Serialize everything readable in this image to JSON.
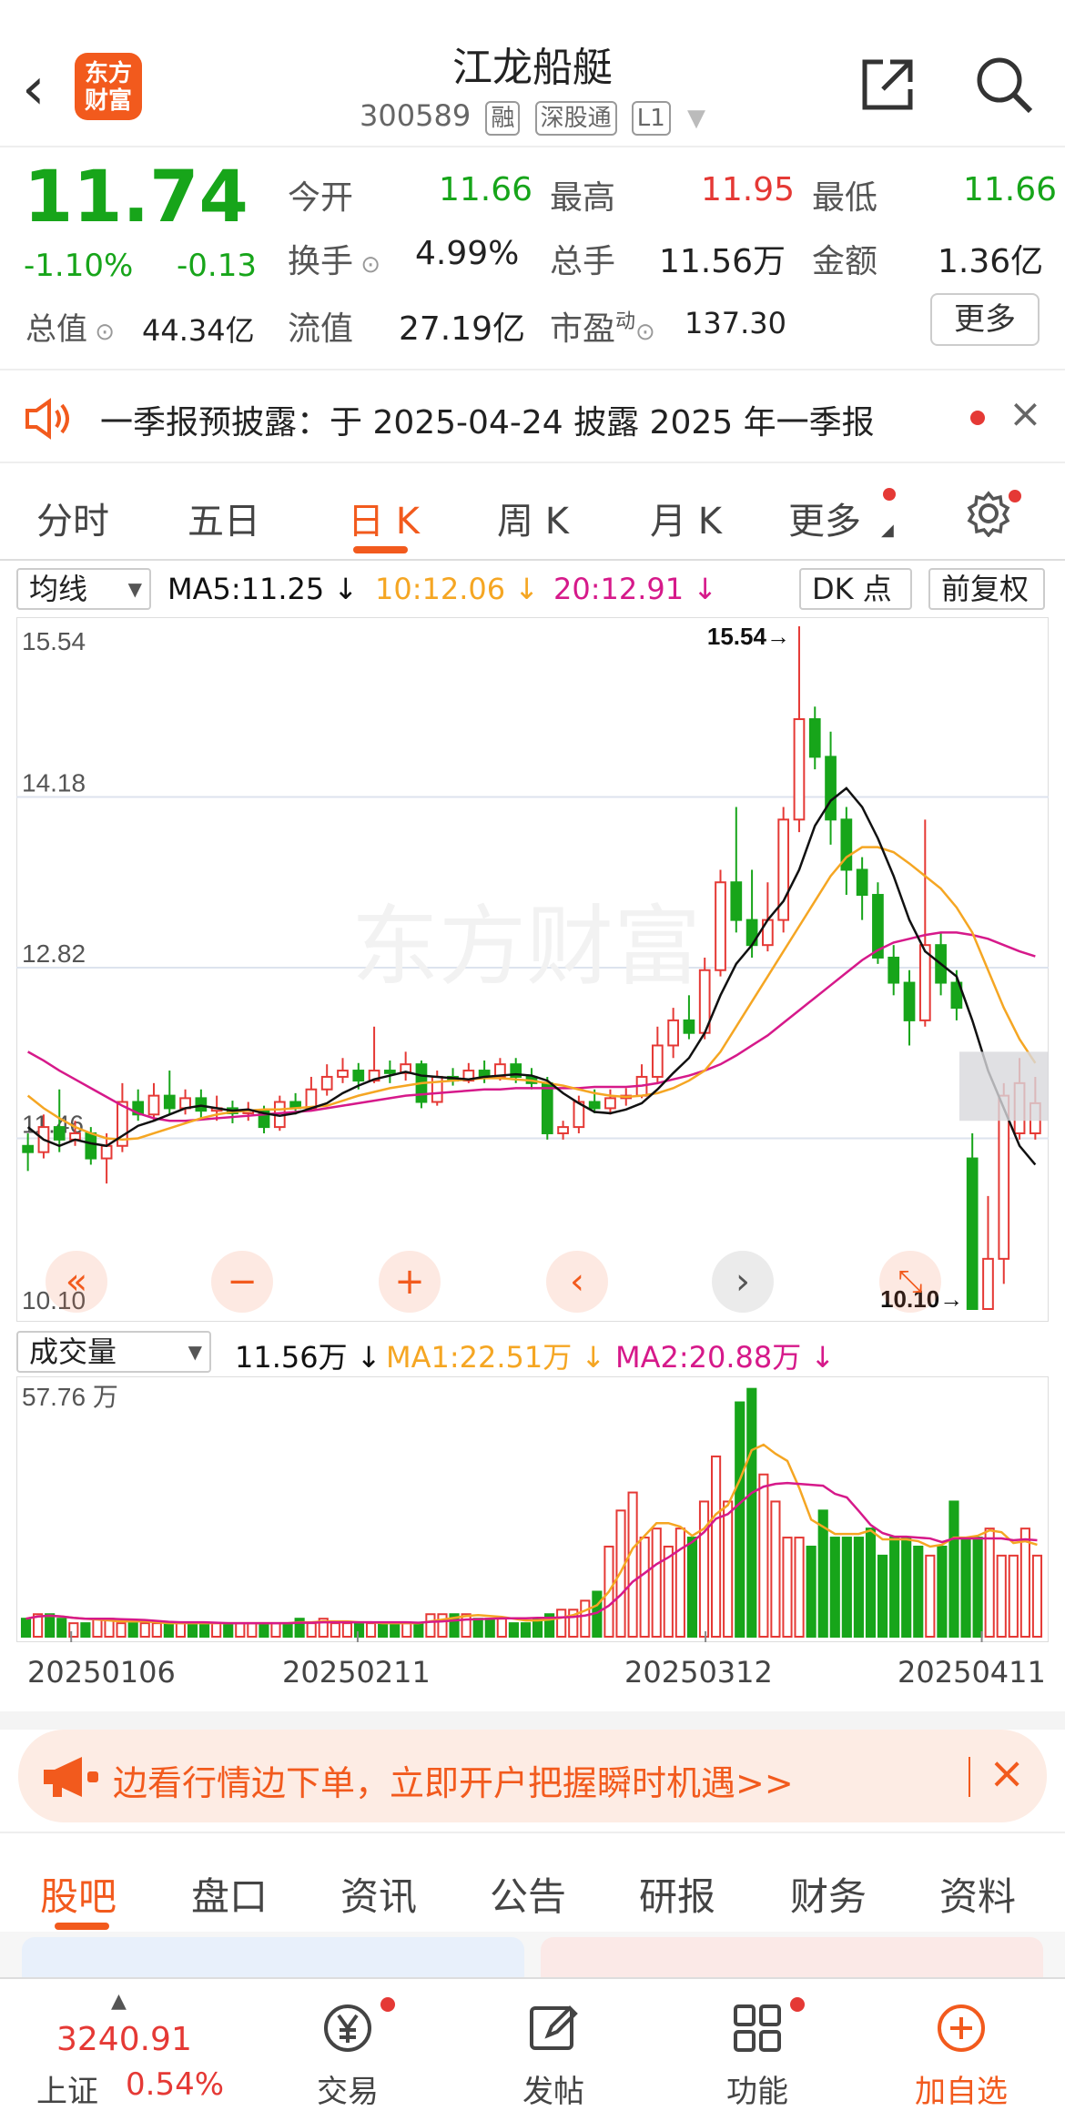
{
  "header": {
    "title": "江龙船艇",
    "code": "300589",
    "tags": [
      "融",
      "深股通",
      "L1"
    ],
    "logo": "东方财富"
  },
  "quote": {
    "price": "11.74",
    "change_pct": "-1.10%",
    "change": "-0.13",
    "open_label": "今开",
    "open": "11.66",
    "high_label": "最高",
    "high": "11.95",
    "low_label": "最低",
    "low": "11.66",
    "turnover_label": "换手",
    "turnover": "4.99%",
    "volume_label": "总手",
    "volume": "11.56万",
    "amount_label": "金额",
    "amount": "1.36亿",
    "mktcap_label": "总值",
    "mktcap": "44.34亿",
    "float_label": "流值",
    "float": "27.19亿",
    "pe_label": "市盈",
    "pe_sup": "动",
    "pe": "137.30",
    "more_label": "更多"
  },
  "notice": {
    "text": "一季报预披露：于 2025-04-24 披露 2025 年一季报"
  },
  "tabs": [
    {
      "label": "分时"
    },
    {
      "label": "五日"
    },
    {
      "label": "日 K"
    },
    {
      "label": "周 K"
    },
    {
      "label": "月 K"
    },
    {
      "label": "更多"
    }
  ],
  "chartbar": {
    "indicator": "均线",
    "ma5": "MA5:11.25 ↓",
    "ma10": "10:12.06 ↓",
    "ma20": "20:12.91 ↓",
    "dk": "DK 点",
    "adjust": "前复权"
  },
  "kline": {
    "axis_labels": [
      "15.54",
      "14.18",
      "12.82",
      "11.46",
      "10.10"
    ],
    "max_label": "15.54→",
    "min_label": "10.10→",
    "watermark": "东方财富"
  },
  "volbar": {
    "indicator": "成交量",
    "vol": "11.56万 ↓",
    "ma1": "MA1:22.51万 ↓",
    "ma2": "MA2:20.88万 ↓",
    "max_label": "57.76 万"
  },
  "dates": [
    "20250106",
    "20250211",
    "20250312",
    "20250411"
  ],
  "ad": {
    "text": "边看行情边下单，立即开户把握瞬时机遇>>"
  },
  "subtabs": [
    {
      "label": "股吧"
    },
    {
      "label": "盘口"
    },
    {
      "label": "资讯"
    },
    {
      "label": "公告"
    },
    {
      "label": "研报"
    },
    {
      "label": "财务"
    },
    {
      "label": "资料"
    }
  ],
  "bottom": {
    "index_value": "3240.91",
    "index_name": "上证",
    "index_change": "0.54%",
    "items": [
      {
        "label": "交易"
      },
      {
        "label": "发帖"
      },
      {
        "label": "功能"
      },
      {
        "label": "加自选"
      }
    ]
  },
  "colors": {
    "up": "#e53935",
    "down": "#17a51a",
    "accent": "#f25a1d",
    "ma5": "#111111",
    "ma10": "#f5a623",
    "ma20": "#d6198a"
  },
  "chart_data": {
    "type": "candlestick",
    "price_axis": [
      10.1,
      15.54
    ],
    "candles": [
      {
        "o": 11.4,
        "c": 11.35,
        "h": 11.5,
        "l": 11.2
      },
      {
        "o": 11.35,
        "c": 11.55,
        "h": 11.65,
        "l": 11.3
      },
      {
        "o": 11.55,
        "c": 11.45,
        "h": 11.85,
        "l": 11.35
      },
      {
        "o": 11.45,
        "c": 11.5,
        "h": 11.6,
        "l": 11.4
      },
      {
        "o": 11.5,
        "c": 11.3,
        "h": 11.55,
        "l": 11.25
      },
      {
        "o": 11.3,
        "c": 11.4,
        "h": 11.5,
        "l": 11.1
      },
      {
        "o": 11.4,
        "c": 11.75,
        "h": 11.9,
        "l": 11.35
      },
      {
        "o": 11.75,
        "c": 11.65,
        "h": 11.85,
        "l": 11.6
      },
      {
        "o": 11.65,
        "c": 11.8,
        "h": 11.9,
        "l": 11.6
      },
      {
        "o": 11.8,
        "c": 11.7,
        "h": 12.0,
        "l": 11.65
      },
      {
        "o": 11.7,
        "c": 11.78,
        "h": 11.85,
        "l": 11.65
      },
      {
        "o": 11.78,
        "c": 11.68,
        "h": 11.85,
        "l": 11.62
      },
      {
        "o": 11.68,
        "c": 11.7,
        "h": 11.8,
        "l": 11.6
      },
      {
        "o": 11.7,
        "c": 11.66,
        "h": 11.76,
        "l": 11.58
      },
      {
        "o": 11.66,
        "c": 11.68,
        "h": 11.75,
        "l": 11.6
      },
      {
        "o": 11.68,
        "c": 11.55,
        "h": 11.72,
        "l": 11.5
      },
      {
        "o": 11.55,
        "c": 11.75,
        "h": 11.8,
        "l": 11.52
      },
      {
        "o": 11.75,
        "c": 11.7,
        "h": 11.82,
        "l": 11.65
      },
      {
        "o": 11.7,
        "c": 11.85,
        "h": 11.95,
        "l": 11.68
      },
      {
        "o": 11.85,
        "c": 11.95,
        "h": 12.05,
        "l": 11.8
      },
      {
        "o": 11.95,
        "c": 12.0,
        "h": 12.1,
        "l": 11.9
      },
      {
        "o": 12.0,
        "c": 11.92,
        "h": 12.06,
        "l": 11.85
      },
      {
        "o": 11.92,
        "c": 12.0,
        "h": 12.35,
        "l": 11.9
      },
      {
        "o": 12.0,
        "c": 11.98,
        "h": 12.08,
        "l": 11.9
      },
      {
        "o": 11.98,
        "c": 12.05,
        "h": 12.15,
        "l": 11.92
      },
      {
        "o": 12.05,
        "c": 11.75,
        "h": 12.08,
        "l": 11.7
      },
      {
        "o": 11.75,
        "c": 11.95,
        "h": 12.0,
        "l": 11.72
      },
      {
        "o": 11.95,
        "c": 11.92,
        "h": 12.02,
        "l": 11.88
      },
      {
        "o": 11.92,
        "c": 12.0,
        "h": 12.06,
        "l": 11.9
      },
      {
        "o": 12.0,
        "c": 11.95,
        "h": 12.08,
        "l": 11.9
      },
      {
        "o": 11.95,
        "c": 12.05,
        "h": 12.1,
        "l": 11.92
      },
      {
        "o": 12.05,
        "c": 11.95,
        "h": 12.1,
        "l": 11.9
      },
      {
        "o": 11.95,
        "c": 11.9,
        "h": 12.02,
        "l": 11.85
      },
      {
        "o": 11.9,
        "c": 11.5,
        "h": 11.95,
        "l": 11.45
      },
      {
        "o": 11.5,
        "c": 11.55,
        "h": 11.6,
        "l": 11.45
      },
      {
        "o": 11.55,
        "c": 11.75,
        "h": 11.8,
        "l": 11.5
      },
      {
        "o": 11.75,
        "c": 11.7,
        "h": 11.85,
        "l": 11.66
      },
      {
        "o": 11.7,
        "c": 11.78,
        "h": 11.85,
        "l": 11.65
      },
      {
        "o": 11.78,
        "c": 11.8,
        "h": 11.86,
        "l": 11.72
      },
      {
        "o": 11.8,
        "c": 11.95,
        "h": 12.05,
        "l": 11.78
      },
      {
        "o": 11.95,
        "c": 12.2,
        "h": 12.35,
        "l": 11.9
      },
      {
        "o": 12.2,
        "c": 12.4,
        "h": 12.5,
        "l": 12.1
      },
      {
        "o": 12.4,
        "c": 12.3,
        "h": 12.6,
        "l": 12.25
      },
      {
        "o": 12.3,
        "c": 12.8,
        "h": 12.9,
        "l": 12.25
      },
      {
        "o": 12.8,
        "c": 13.5,
        "h": 13.6,
        "l": 12.75
      },
      {
        "o": 13.5,
        "c": 13.2,
        "h": 14.1,
        "l": 13.1
      },
      {
        "o": 13.2,
        "c": 13.0,
        "h": 13.6,
        "l": 12.9
      },
      {
        "o": 13.0,
        "c": 13.2,
        "h": 13.5,
        "l": 12.95
      },
      {
        "o": 13.2,
        "c": 14.0,
        "h": 14.1,
        "l": 13.1
      },
      {
        "o": 14.0,
        "c": 14.8,
        "h": 15.54,
        "l": 13.9
      },
      {
        "o": 14.8,
        "c": 14.5,
        "h": 14.9,
        "l": 14.4
      },
      {
        "o": 14.5,
        "c": 14.0,
        "h": 14.7,
        "l": 13.8
      },
      {
        "o": 14.0,
        "c": 13.6,
        "h": 14.1,
        "l": 13.4
      },
      {
        "o": 13.6,
        "c": 13.4,
        "h": 13.7,
        "l": 13.2
      },
      {
        "o": 13.4,
        "c": 12.9,
        "h": 13.5,
        "l": 12.85
      },
      {
        "o": 12.9,
        "c": 12.7,
        "h": 13.0,
        "l": 12.6
      },
      {
        "o": 12.7,
        "c": 12.4,
        "h": 12.8,
        "l": 12.2
      },
      {
        "o": 12.4,
        "c": 13.0,
        "h": 14.0,
        "l": 12.35
      },
      {
        "o": 13.0,
        "c": 12.7,
        "h": 13.1,
        "l": 12.6
      },
      {
        "o": 12.7,
        "c": 12.5,
        "h": 12.8,
        "l": 12.4
      },
      {
        "o": 11.3,
        "c": 10.1,
        "h": 11.5,
        "l": 10.1
      },
      {
        "o": 10.1,
        "c": 10.5,
        "h": 11.0,
        "l": 10.1
      },
      {
        "o": 10.5,
        "c": 11.8,
        "h": 11.9,
        "l": 10.3
      },
      {
        "o": 11.5,
        "c": 11.9,
        "h": 12.1,
        "l": 11.45
      },
      {
        "o": 11.5,
        "c": 11.74,
        "h": 11.95,
        "l": 11.45
      }
    ],
    "ma5": [
      11.55,
      11.45,
      11.4,
      11.45,
      11.42,
      11.4,
      11.48,
      11.56,
      11.6,
      11.65,
      11.7,
      11.72,
      11.7,
      11.68,
      11.69,
      11.66,
      11.64,
      11.66,
      11.7,
      11.74,
      11.82,
      11.88,
      11.93,
      11.96,
      11.99,
      11.96,
      11.95,
      11.94,
      11.93,
      11.95,
      11.96,
      11.97,
      11.96,
      11.92,
      11.82,
      11.74,
      11.67,
      11.66,
      11.69,
      11.74,
      11.85,
      11.98,
      12.1,
      12.3,
      12.6,
      12.85,
      13.0,
      13.2,
      13.35,
      13.6,
      13.95,
      14.15,
      14.25,
      14.1,
      13.85,
      13.55,
      13.2,
      12.95,
      12.85,
      12.75,
      12.4,
      12.0,
      11.7,
      11.4,
      11.25
    ],
    "ma10": [
      11.8,
      11.7,
      11.62,
      11.55,
      11.5,
      11.46,
      11.45,
      11.46,
      11.5,
      11.54,
      11.58,
      11.62,
      11.65,
      11.67,
      11.68,
      11.69,
      11.69,
      11.7,
      11.71,
      11.72,
      11.76,
      11.8,
      11.83,
      11.86,
      11.88,
      11.9,
      11.91,
      11.92,
      11.93,
      11.94,
      11.94,
      11.93,
      11.92,
      11.9,
      11.88,
      11.85,
      11.82,
      11.8,
      11.79,
      11.8,
      11.82,
      11.86,
      11.92,
      12.0,
      12.15,
      12.35,
      12.55,
      12.75,
      12.95,
      13.15,
      13.35,
      13.55,
      13.7,
      13.78,
      13.78,
      13.74,
      13.65,
      13.55,
      13.45,
      13.3,
      13.1,
      12.8,
      12.5,
      12.25,
      12.06
    ],
    "ma20": [
      12.15,
      12.08,
      12.0,
      11.93,
      11.86,
      11.79,
      11.72,
      11.66,
      11.62,
      11.6,
      11.6,
      11.61,
      11.62,
      11.63,
      11.64,
      11.65,
      11.66,
      11.67,
      11.68,
      11.7,
      11.72,
      11.74,
      11.76,
      11.78,
      11.8,
      11.81,
      11.82,
      11.83,
      11.84,
      11.85,
      11.85,
      11.86,
      11.86,
      11.86,
      11.86,
      11.86,
      11.87,
      11.87,
      11.87,
      11.88,
      11.9,
      11.93,
      11.96,
      12.0,
      12.05,
      12.12,
      12.2,
      12.28,
      12.38,
      12.48,
      12.58,
      12.68,
      12.78,
      12.88,
      12.96,
      13.02,
      13.05,
      13.08,
      13.1,
      13.1,
      13.08,
      13.05,
      13.0,
      12.95,
      12.91
    ],
    "volume_axis_max": 57.76,
    "volume_unit": "万",
    "volumes": [
      4,
      5,
      5,
      4,
      3,
      3,
      4,
      4,
      3,
      3,
      3,
      3,
      3,
      3,
      3,
      3,
      3,
      3,
      3,
      3,
      3,
      3,
      3,
      4,
      3,
      4,
      3,
      3,
      3,
      3,
      3,
      3,
      3,
      3,
      5,
      5,
      5,
      5,
      4,
      4,
      4,
      3,
      3,
      4,
      5,
      6,
      6,
      8,
      10,
      20,
      28,
      32,
      22,
      24,
      20,
      24,
      22,
      30,
      40,
      30,
      52,
      55,
      36,
      30,
      22,
      22,
      20,
      28,
      22,
      22,
      22,
      24,
      18,
      22,
      22,
      20,
      18,
      20,
      30,
      22,
      22,
      24,
      18,
      18,
      24,
      18
    ]
  }
}
